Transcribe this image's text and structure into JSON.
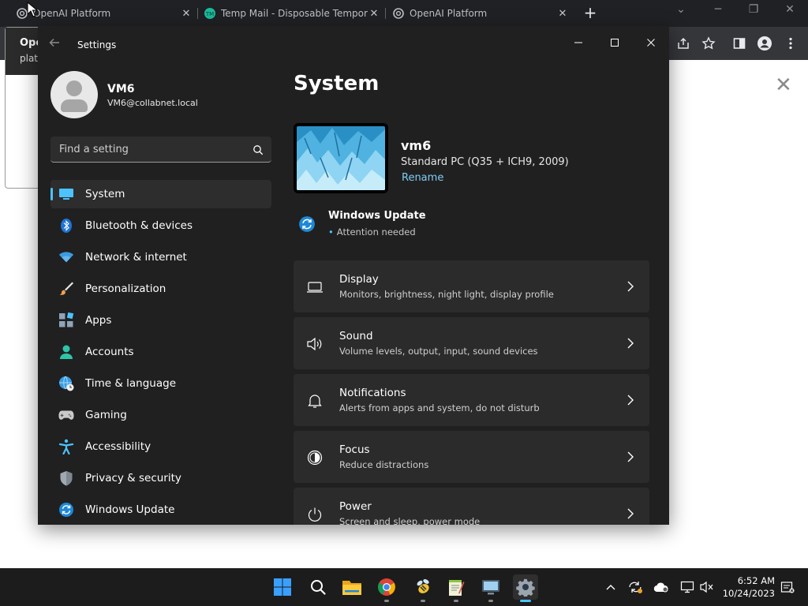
{
  "browser": {
    "tabs": [
      {
        "title": "OpenAI Platform",
        "close": "✕"
      },
      {
        "title": "Temp Mail - Disposable Temporary Email",
        "close": "✕"
      },
      {
        "title": "OpenAI Platform",
        "close": "✕"
      }
    ],
    "new_tab": "+",
    "popup": {
      "title": "Ope",
      "subtitle": "platf"
    },
    "page_close": "✕"
  },
  "settings": {
    "app_title": "Settings",
    "user": {
      "name": "VM6",
      "email": "VM6@collabnet.local"
    },
    "search_placeholder": "Find a setting",
    "nav": [
      {
        "label": "System",
        "active": true
      },
      {
        "label": "Bluetooth & devices"
      },
      {
        "label": "Network & internet"
      },
      {
        "label": "Personalization"
      },
      {
        "label": "Apps"
      },
      {
        "label": "Accounts"
      },
      {
        "label": "Time & language"
      },
      {
        "label": "Gaming"
      },
      {
        "label": "Accessibility"
      },
      {
        "label": "Privacy & security"
      },
      {
        "label": "Windows Update"
      }
    ],
    "main": {
      "title": "System",
      "device": {
        "name": "vm6",
        "model": "Standard PC (Q35 + ICH9, 2009)",
        "rename": "Rename"
      },
      "update": {
        "title": "Windows Update",
        "status": "Attention needed"
      },
      "cards": [
        {
          "title": "Display",
          "subtitle": "Monitors, brightness, night light, display profile"
        },
        {
          "title": "Sound",
          "subtitle": "Volume levels, output, input, sound devices"
        },
        {
          "title": "Notifications",
          "subtitle": "Alerts from apps and system, do not disturb"
        },
        {
          "title": "Focus",
          "subtitle": "Reduce distractions"
        },
        {
          "title": "Power",
          "subtitle": "Screen and sleep, power mode"
        }
      ]
    }
  },
  "taskbar": {
    "time": "6:52 AM",
    "date": "10/24/2023"
  },
  "colors": {
    "accent": "#4cc2ff",
    "link": "#7ecdf5",
    "window_bg": "#202020",
    "card_bg": "#2b2b2b"
  }
}
